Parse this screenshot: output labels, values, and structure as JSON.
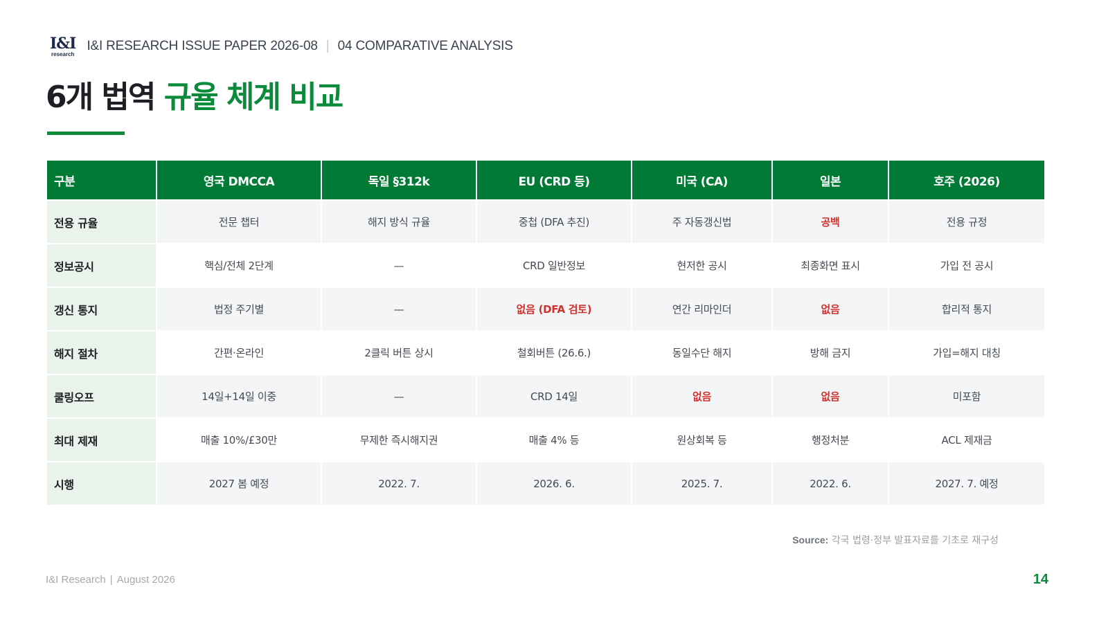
{
  "header": {
    "logo_main": "I&I",
    "logo_sub": "research",
    "paper": "I&I RESEARCH ISSUE PAPER 2026-08",
    "section": "04  COMPARATIVE ANALYSIS"
  },
  "title": {
    "dark": "6개 법역",
    "green": "규율 체계 비교"
  },
  "colors": {
    "brand_green": "#007a35",
    "title_green": "#0a8a3a",
    "alert_red": "#d0312d",
    "row_head_bg": "#e9f3ec"
  },
  "table": {
    "headers": [
      "구분",
      "영국 DMCCA",
      "독일 §312k",
      "EU (CRD 등)",
      "미국 (CA)",
      "일본",
      "호주 (2026)"
    ],
    "rows": [
      {
        "label": "전용 규율",
        "cells": [
          {
            "text": "전문 챕터",
            "alert": false
          },
          {
            "text": "해지 방식 규율",
            "alert": false
          },
          {
            "text": "중첩 (DFA 추진)",
            "alert": false
          },
          {
            "text": "주 자동갱신법",
            "alert": false
          },
          {
            "text": "공백",
            "alert": true
          },
          {
            "text": "전용 규정",
            "alert": false
          }
        ]
      },
      {
        "label": "정보공시",
        "cells": [
          {
            "text": "핵심/전체 2단계",
            "alert": false
          },
          {
            "text": "—",
            "alert": false
          },
          {
            "text": "CRD 일반정보",
            "alert": false
          },
          {
            "text": "현저한 공시",
            "alert": false
          },
          {
            "text": "최종화면 표시",
            "alert": false
          },
          {
            "text": "가입 전 공시",
            "alert": false
          }
        ]
      },
      {
        "label": "갱신 통지",
        "cells": [
          {
            "text": "법정 주기별",
            "alert": false
          },
          {
            "text": "—",
            "alert": false
          },
          {
            "text": "없음 (DFA 검토)",
            "alert": true
          },
          {
            "text": "연간 리마인더",
            "alert": false
          },
          {
            "text": "없음",
            "alert": true
          },
          {
            "text": "합리적 통지",
            "alert": false
          }
        ]
      },
      {
        "label": "해지 절차",
        "cells": [
          {
            "text": "간편·온라인",
            "alert": false
          },
          {
            "text": "2클릭 버튼 상시",
            "alert": false
          },
          {
            "text": "철회버튼 (26.6.)",
            "alert": false
          },
          {
            "text": "동일수단 해지",
            "alert": false
          },
          {
            "text": "방해 금지",
            "alert": false
          },
          {
            "text": "가입=해지 대칭",
            "alert": false
          }
        ]
      },
      {
        "label": "쿨링오프",
        "cells": [
          {
            "text": "14일+14일 이중",
            "alert": false
          },
          {
            "text": "—",
            "alert": false
          },
          {
            "text": "CRD 14일",
            "alert": false
          },
          {
            "text": "없음",
            "alert": true
          },
          {
            "text": "없음",
            "alert": true
          },
          {
            "text": "미포함",
            "alert": false
          }
        ]
      },
      {
        "label": "최대 제재",
        "cells": [
          {
            "text": "매출 10%/£30만",
            "alert": false
          },
          {
            "text": "무제한 즉시해지권",
            "alert": false
          },
          {
            "text": "매출 4% 등",
            "alert": false
          },
          {
            "text": "원상회복 등",
            "alert": false
          },
          {
            "text": "행정처분",
            "alert": false
          },
          {
            "text": "ACL 제재금",
            "alert": false
          }
        ]
      },
      {
        "label": "시행",
        "cells": [
          {
            "text": "2027 봄 예정",
            "alert": false
          },
          {
            "text": "2022. 7.",
            "alert": false
          },
          {
            "text": "2026. 6.",
            "alert": false
          },
          {
            "text": "2025. 7.",
            "alert": false
          },
          {
            "text": "2022. 6.",
            "alert": false
          },
          {
            "text": "2027. 7. 예정",
            "alert": false
          }
        ]
      }
    ]
  },
  "source": {
    "label": "Source:",
    "text": "각국 법령·정부 발표자료를 기초로 재구성"
  },
  "footer": {
    "org": "I&I Research",
    "date": "August 2026",
    "page": "14"
  }
}
